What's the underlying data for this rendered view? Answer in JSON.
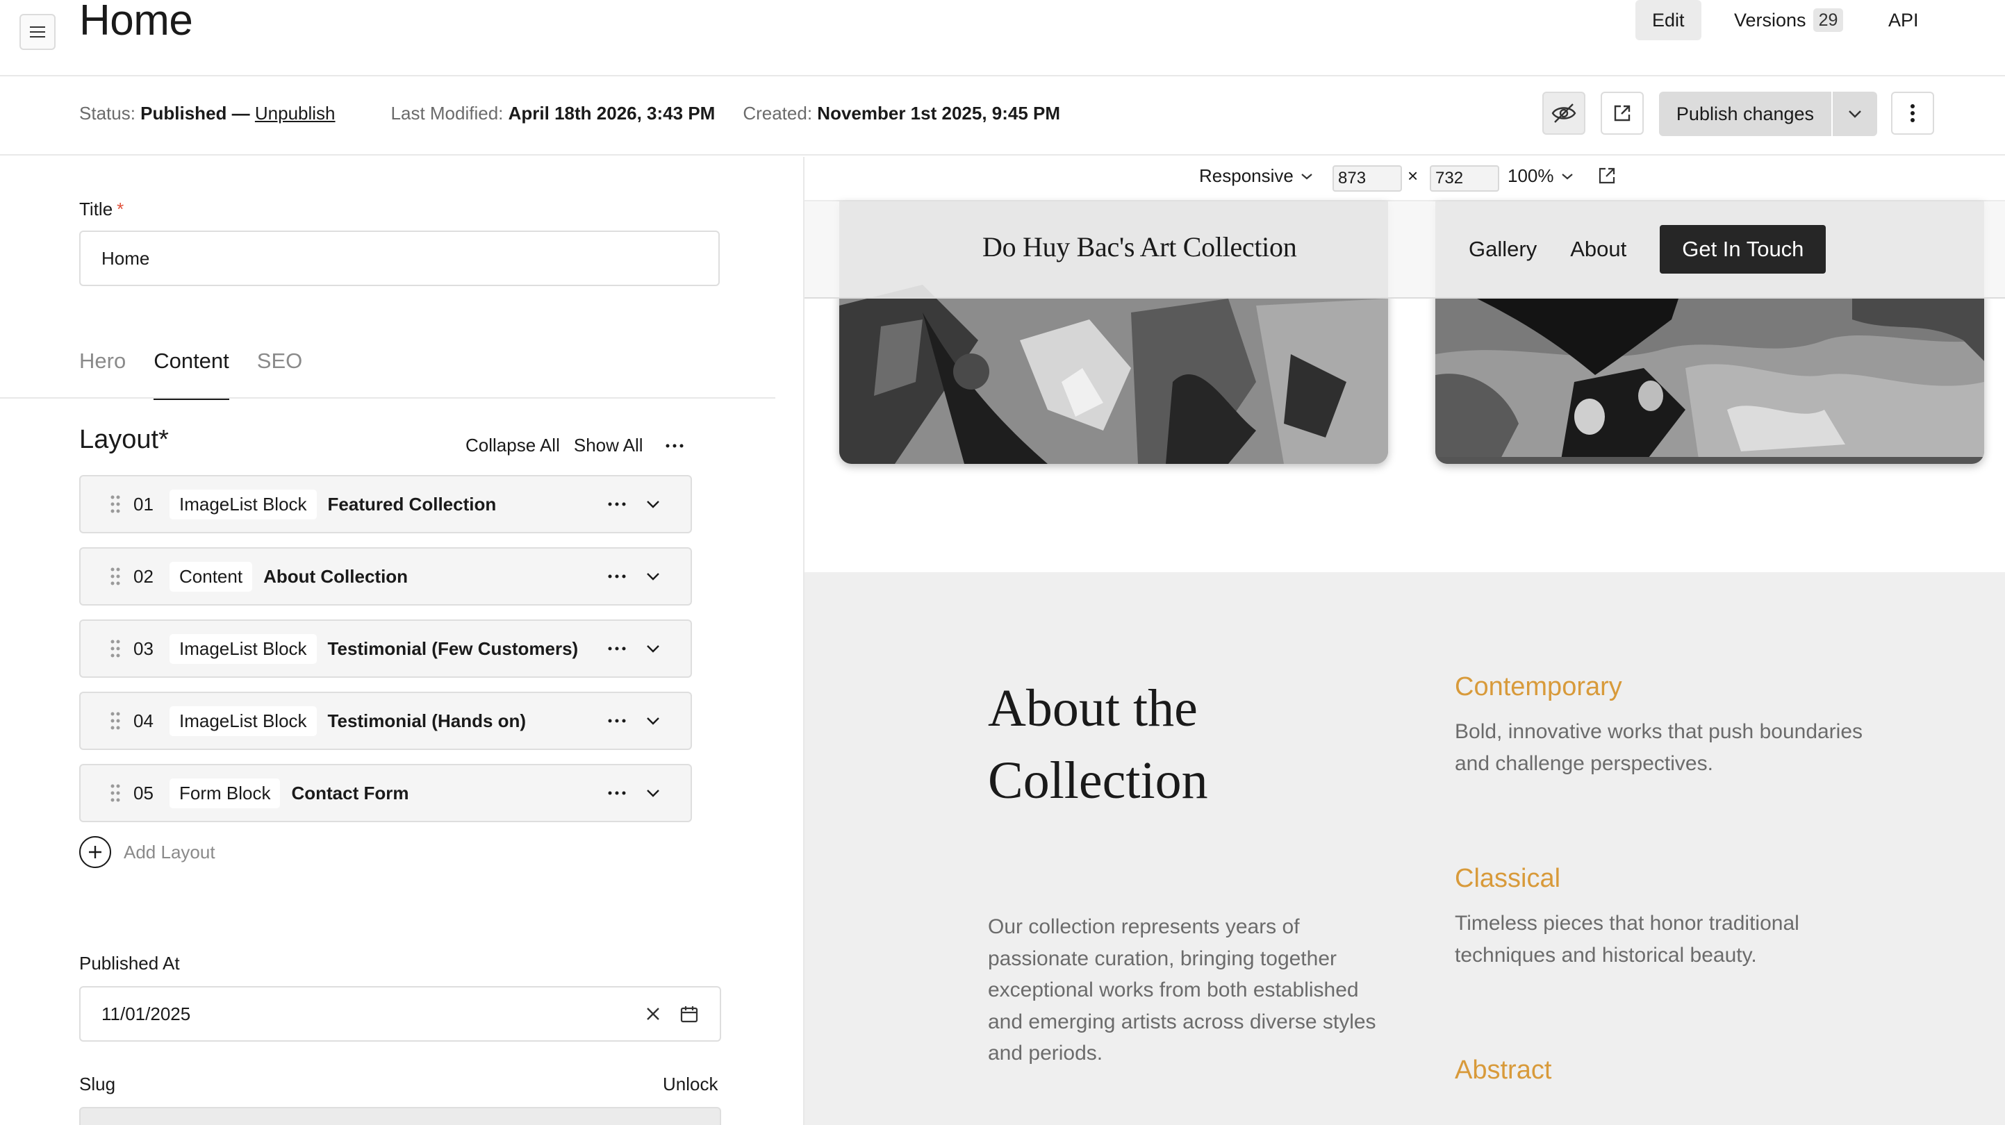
{
  "header": {
    "title": "Home",
    "tabs": [
      {
        "label": "Edit",
        "active": true
      },
      {
        "label": "Versions",
        "count": "29"
      },
      {
        "label": "API"
      }
    ]
  },
  "status": {
    "status_label": "Status:",
    "status_value": "Published",
    "separator": "—",
    "unpublish_link": "Unpublish",
    "modified_label": "Last Modified:",
    "modified_value": "April 18th 2026, 3:43 PM",
    "created_label": "Created:",
    "created_value": "November 1st 2025, 9:45 PM",
    "publish_button": "Publish changes"
  },
  "form": {
    "title_label": "Title",
    "required_mark": "*",
    "title_value": "Home",
    "tabs": [
      "Hero",
      "Content",
      "SEO"
    ],
    "active_tab": "Content",
    "layout_heading": "Layout*",
    "collapse_all": "Collapse All",
    "show_all": "Show All",
    "blocks": [
      {
        "num": "01",
        "type": "ImageList Block",
        "name": "Featured Collection"
      },
      {
        "num": "02",
        "type": "Content",
        "name": "About Collection"
      },
      {
        "num": "03",
        "type": "ImageList Block",
        "name": "Testimonial (Few Customers)"
      },
      {
        "num": "04",
        "type": "ImageList Block",
        "name": "Testimonial (Hands on)"
      },
      {
        "num": "05",
        "type": "Form Block",
        "name": "Contact Form"
      }
    ],
    "add_layout": "Add Layout",
    "published_at_label": "Published At",
    "published_at_value": "11/01/2025",
    "slug_label": "Slug",
    "slug_unlock": "Unlock"
  },
  "preview": {
    "mode": "Responsive",
    "width": "873",
    "height": "732",
    "times": "×",
    "zoom": "100%"
  },
  "site": {
    "brand": "Do Huy Bac's Art Collection",
    "nav": [
      "Gallery",
      "About"
    ],
    "cta": "Get In Touch",
    "about_title": "About the Collection",
    "about_body": "Our collection represents years of passionate curation, bringing together exceptional works from both established and emerging artists across diverse styles and periods.",
    "categories": [
      {
        "name": "Contemporary",
        "desc": "Bold, innovative works that push boundaries and challenge perspectives."
      },
      {
        "name": "Classical",
        "desc": "Timeless pieces that honor traditional techniques and historical beauty."
      },
      {
        "name": "Abstract",
        "desc": ""
      }
    ]
  },
  "colors": {
    "accent_gold": "#d89a3a",
    "dark_button": "#262626",
    "border": "#dedede",
    "muted_text": "#6b6b6b"
  }
}
